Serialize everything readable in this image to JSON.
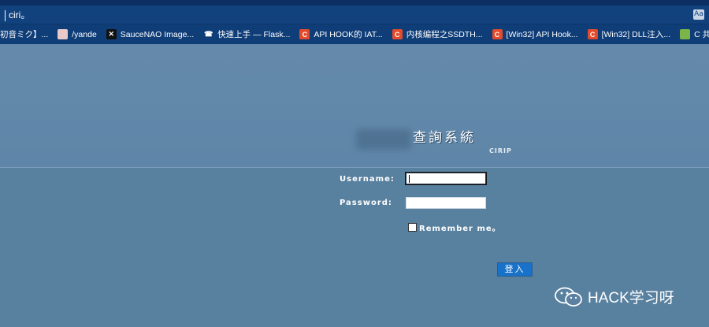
{
  "browser": {
    "address_text": "ciri。",
    "translate_icon": "Aa"
  },
  "bookmarks": [
    {
      "label": "初音ミク】...",
      "icon": "anime-icon"
    },
    {
      "label": "/yande",
      "icon": "anime-icon"
    },
    {
      "label": "SauceNAO Image...",
      "icon": "x-icon"
    },
    {
      "label": "快速上手 — Flask...",
      "icon": "phone-icon"
    },
    {
      "label": "API HOOK的 IAT...",
      "icon": "c-icon"
    },
    {
      "label": "内核编程之SSDTH...",
      "icon": "c-icon"
    },
    {
      "label": "[Win32] API Hook...",
      "icon": "c-icon"
    },
    {
      "label": "[Win32] DLL注入...",
      "icon": "c-icon"
    },
    {
      "label": "C 共用体 | 菜鸟教程",
      "icon": "runoob-icon"
    }
  ],
  "login": {
    "title": "查詢系統",
    "subtitle": "CIRIP",
    "username_label": "Username:",
    "password_label": "Password:",
    "username_value": "",
    "password_value": "",
    "remember_label": "Remember me。",
    "submit_label": "登入"
  },
  "watermark": {
    "text": "HACK学习呀"
  },
  "colors": {
    "page_bg": "#5f86a8",
    "button_bg": "#1872c9",
    "chrome_bg": "#12427e"
  }
}
